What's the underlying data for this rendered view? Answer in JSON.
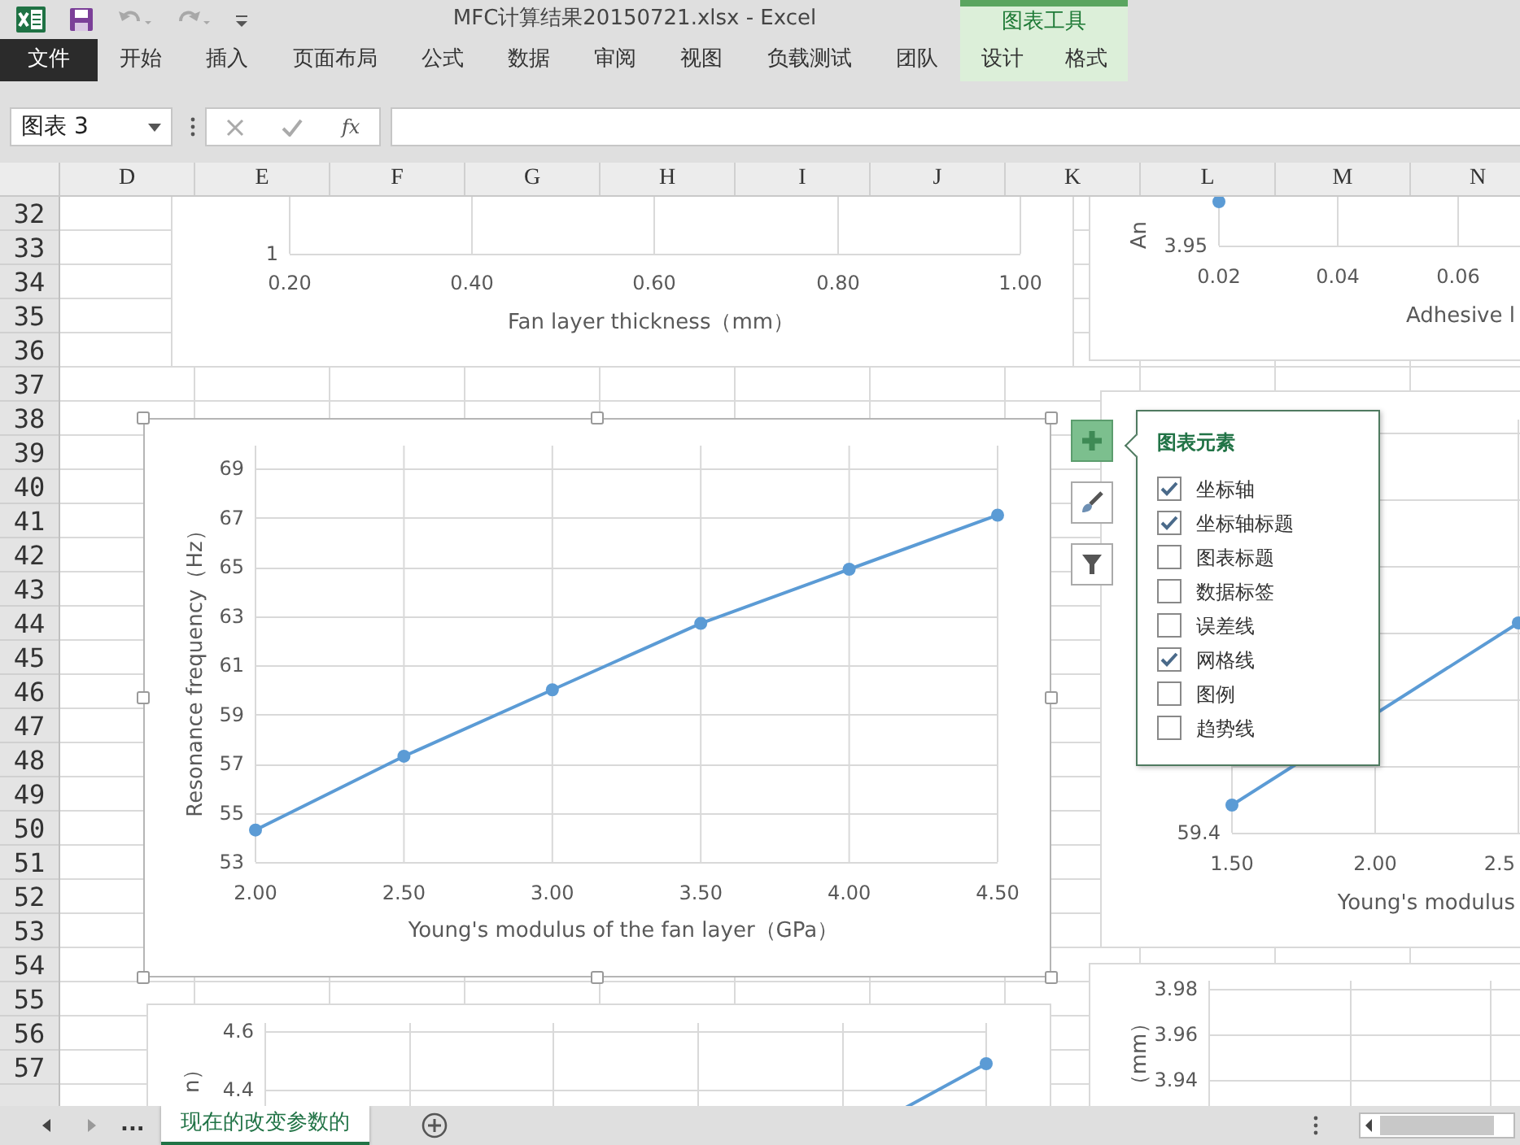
{
  "window": {
    "title": "MFC计算结果20150721.xlsx - Excel"
  },
  "quick_access": [
    {
      "kind": "save",
      "disabled": false
    },
    {
      "kind": "undo",
      "disabled": true
    },
    {
      "kind": "redo",
      "disabled": true
    },
    {
      "kind": "customize",
      "disabled": false
    }
  ],
  "context_tab_group": {
    "title": "图表工具"
  },
  "ribbon_tabs": [
    {
      "label": "文件",
      "kind": "file"
    },
    {
      "label": "开始",
      "kind": "tab"
    },
    {
      "label": "插入",
      "kind": "tab"
    },
    {
      "label": "页面布局",
      "kind": "tab"
    },
    {
      "label": "公式",
      "kind": "tab"
    },
    {
      "label": "数据",
      "kind": "tab"
    },
    {
      "label": "审阅",
      "kind": "tab"
    },
    {
      "label": "视图",
      "kind": "tab"
    },
    {
      "label": "负载测试",
      "kind": "tab"
    },
    {
      "label": "团队",
      "kind": "tab"
    },
    {
      "label": "设计",
      "kind": "context"
    },
    {
      "label": "格式",
      "kind": "context"
    }
  ],
  "formula_bar": {
    "name_box": "图表 3",
    "function_label": "fx"
  },
  "columns": [
    "D",
    "E",
    "F",
    "G",
    "H",
    "I",
    "J",
    "K",
    "L",
    "M",
    "N"
  ],
  "rows": [
    "32",
    "33",
    "34",
    "35",
    "36",
    "37",
    "38",
    "39",
    "40",
    "41",
    "42",
    "43",
    "44",
    "45",
    "46",
    "47",
    "48",
    "49",
    "50",
    "51",
    "52",
    "53",
    "54",
    "55",
    "56",
    "57"
  ],
  "charts": [
    {
      "kind": "partial",
      "selected": false,
      "x_tick_labels": [
        "0.20",
        "0.40",
        "0.60",
        "0.80",
        "1.00"
      ],
      "y_tick_labels": [
        "1"
      ],
      "x_axis_title": "Fan layer thickness（mm）"
    },
    {
      "kind": "partial",
      "selected": false,
      "x_tick_labels": [
        "0.02",
        "0.04",
        "0.06"
      ],
      "y_tick_labels": [
        "3.95"
      ],
      "x_axis_title": "Adhesive l",
      "y_axis_title": "An"
    },
    {
      "kind": "chart",
      "selected": true,
      "chart_data": {
        "type": "line",
        "xlabel": "Young's modulus of the fan layer（GPa）",
        "ylabel": "Resonance frequency（Hz）",
        "x": [
          2.0,
          2.5,
          3.0,
          3.5,
          4.0,
          4.5
        ],
        "xlim": [
          2.0,
          4.5
        ],
        "ylim": [
          53,
          69
        ],
        "grid": true,
        "xticks": [
          {
            "value": 2.0,
            "label": "2.00"
          },
          {
            "value": 2.5,
            "label": "2.50"
          },
          {
            "value": 3.0,
            "label": "3.00"
          },
          {
            "value": 3.5,
            "label": "3.50"
          },
          {
            "value": 4.0,
            "label": "4.00"
          },
          {
            "value": 4.5,
            "label": "4.50"
          }
        ],
        "yticks": [
          53,
          55,
          57,
          59,
          61,
          63,
          65,
          67,
          69
        ],
        "series": [
          {
            "color": "#5b9bd5",
            "marker": true,
            "values": [
              54.3,
              57.3,
              60.0,
              62.7,
              64.9,
              67.1
            ]
          }
        ]
      }
    },
    {
      "kind": "partial",
      "selected": false,
      "x_tick_labels": [
        "1.50",
        "2.00",
        "2.5"
      ],
      "y_tick_labels": [
        "59.4"
      ],
      "x_axis_title": "Young's modulus"
    },
    {
      "kind": "partial",
      "selected": false,
      "y_tick_labels": [
        "4.6",
        "4.4"
      ],
      "y_axis_title": "n）"
    },
    {
      "kind": "partial",
      "selected": false,
      "y_tick_labels": [
        "3.98",
        "3.96",
        "3.94"
      ],
      "y_axis_title": "（mm）"
    }
  ],
  "chart_tools": [
    {
      "kind": "elements",
      "selected": true
    },
    {
      "kind": "styles",
      "selected": false
    },
    {
      "kind": "filter",
      "selected": false
    }
  ],
  "chart_elements_panel": {
    "title": "图表元素",
    "items": [
      {
        "label": "坐标轴",
        "checked": true
      },
      {
        "label": "坐标轴标题",
        "checked": true
      },
      {
        "label": "图表标题",
        "checked": false
      },
      {
        "label": "数据标签",
        "checked": false
      },
      {
        "label": "误差线",
        "checked": false
      },
      {
        "label": "网格线",
        "checked": true
      },
      {
        "label": "图例",
        "checked": false
      },
      {
        "label": "趋势线",
        "checked": false
      }
    ]
  },
  "sheet_tabs": {
    "overflow": "...",
    "tabs": [
      {
        "label": "现在的改变参数的",
        "selected": true
      }
    ]
  }
}
